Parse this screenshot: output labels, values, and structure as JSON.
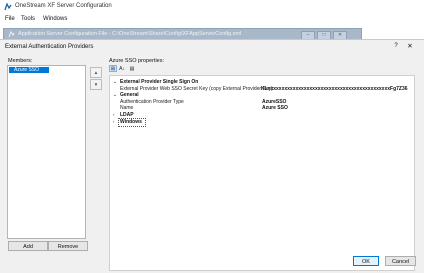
{
  "app": {
    "title": "OneStream XF Server Configuration"
  },
  "menu": [
    {
      "label": "File"
    },
    {
      "label": "Tools"
    },
    {
      "label": "Windows"
    }
  ],
  "child_window": {
    "title": "Application Server Configuration File - C:\\OneStream\\Share\\Config\\XFAppServerConfig.xml"
  },
  "dialog": {
    "title": "External Authentication Providers",
    "help": "?",
    "close": "✕",
    "members_label": "Members:",
    "members": [
      {
        "label": "Azure SSO"
      }
    ],
    "add_label": "Add",
    "remove_label": "Remove",
    "up_icon": "▲",
    "down_icon": "▼",
    "properties_label": "Azure SSO properties:",
    "ok_label": "OK",
    "cancel_label": "Cancel",
    "toolbar": [
      {
        "name": "categorized",
        "glyph": "⊞"
      },
      {
        "name": "alphabetical",
        "glyph": "A↓"
      },
      {
        "name": "property-pages",
        "glyph": "▤"
      }
    ],
    "grid": {
      "categories": [
        {
          "name": "External Provider Single Sign On",
          "expanded": true,
          "properties": [
            {
              "name": "External Provider Web SSO Secret Key (copy External Provider Key):",
              "value": "KLxxxxxxxxxxxxxxxxxxxxxxxxxxxxxxxxxxxxxxxxxxxxFg7Z36"
            }
          ]
        },
        {
          "name": "General",
          "expanded": true,
          "properties": [
            {
              "name": "Authentication Provider Type",
              "value": "AzureSSO"
            },
            {
              "name": "Name",
              "value": "Azure SSO"
            }
          ]
        },
        {
          "name": "LDAP",
          "expanded": false,
          "properties": []
        },
        {
          "name": "Windows",
          "expanded": false,
          "properties": []
        }
      ]
    }
  }
}
